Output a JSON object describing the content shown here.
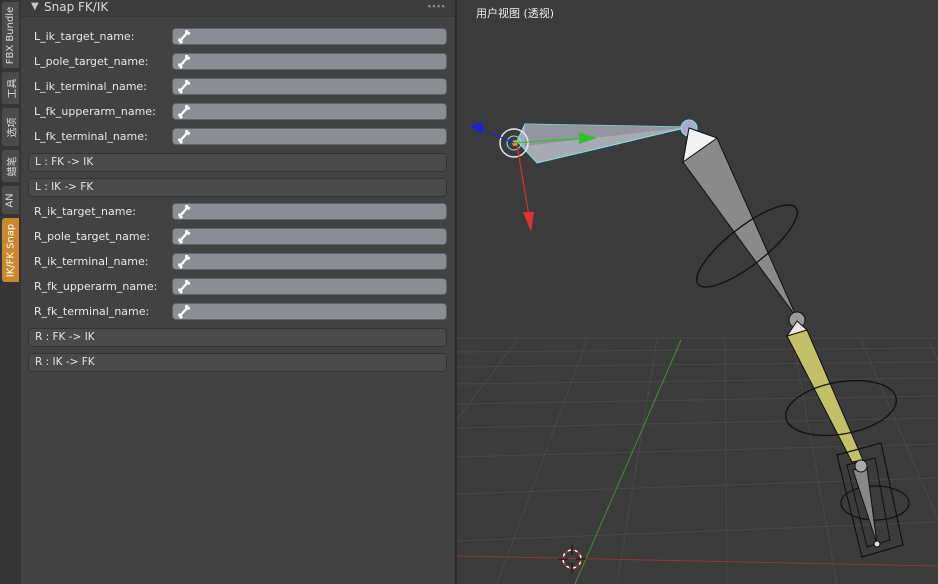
{
  "tabs": [
    {
      "label": "FBX Bundle",
      "active": false
    },
    {
      "label": "工具",
      "active": false
    },
    {
      "label": "选项",
      "active": false
    },
    {
      "label": "蜡笔",
      "active": false
    },
    {
      "label": "AN",
      "active": false
    },
    {
      "label": "IK/FK Snap",
      "active": true
    }
  ],
  "panel": {
    "title": "Snap FK/IK",
    "left_fields": [
      {
        "label": "L_ik_target_name:",
        "value": ""
      },
      {
        "label": "L_pole_target_name:",
        "value": ""
      },
      {
        "label": "L_ik_terminal_name:",
        "value": ""
      },
      {
        "label": "L_fk_upperarm_name:",
        "value": ""
      },
      {
        "label": "L_fk_terminal_name:",
        "value": ""
      }
    ],
    "left_buttons": [
      "L : FK -> IK",
      "L : IK -> FK"
    ],
    "right_fields": [
      {
        "label": "R_ik_target_name:",
        "value": ""
      },
      {
        "label": "R_pole_target_name:",
        "value": ""
      },
      {
        "label": "R_ik_terminal_name:",
        "value": ""
      },
      {
        "label": "R_fk_upperarm_name:",
        "value": ""
      },
      {
        "label": "R_fk_terminal_name:",
        "value": ""
      }
    ],
    "right_buttons": [
      "R : FK -> IK",
      "R : IK -> FK"
    ]
  },
  "viewport": {
    "title": "用户视图 (透视)"
  },
  "colors": {
    "active_tab": "#c8882f",
    "field_bg": "#8b8f93",
    "selected_bone_outline": "#7fe6e6",
    "ik_bone": "#c2c068",
    "axis_x": "#e03030",
    "axis_y": "#30c030",
    "axis_z": "#2020d0"
  }
}
